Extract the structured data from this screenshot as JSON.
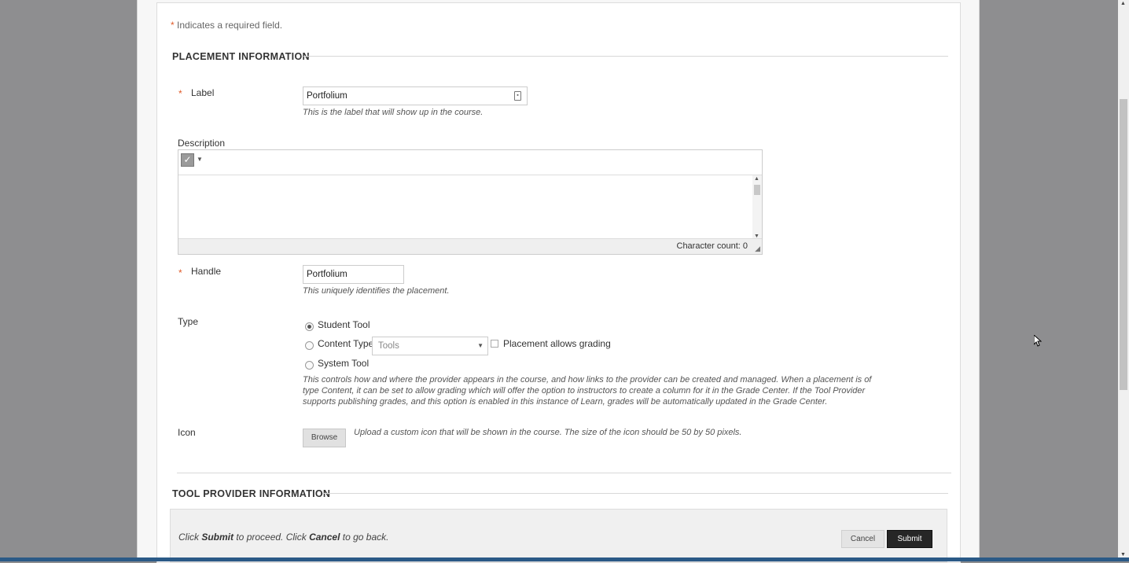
{
  "form": {
    "required_note": "Indicates a required field.",
    "required_mark": "*",
    "placement_section_title": "PLACEMENT INFORMATION",
    "label": {
      "label": "Label",
      "value": "Portfolium",
      "hint": "This is the label that will show up in the course."
    },
    "description": {
      "label": "Description",
      "char_count": "Character count: 0"
    },
    "handle": {
      "label": "Handle",
      "value": "Portfolium",
      "hint": "This uniquely identifies the placement."
    },
    "type": {
      "label": "Type",
      "options": [
        {
          "label": "Student Tool",
          "selected": true
        },
        {
          "label": "Content Type",
          "selected": false
        },
        {
          "label": "System Tool",
          "selected": false
        }
      ],
      "content_type_select": "Tools",
      "grading_checkbox_label": "Placement allows grading",
      "grading_checked": false,
      "hint": "This controls how and where the provider appears in the course, and how links to the provider can be created and managed. When a placement is of type Content, it can be set to allow grading which will offer the option to instructors to create a column for it in the Grade Center. If the Tool Provider supports publishing grades, and this option is enabled in this instance of Learn, grades will be automatically updated in the Grade Center."
    },
    "icon": {
      "label": "Icon",
      "browse_button": "Browse",
      "hint": "Upload a custom icon that will be shown in the course. The size of the icon should be 50 by 50 pixels."
    },
    "tool_provider_section_title": "TOOL PROVIDER INFORMATION"
  },
  "submit_bar": {
    "text_1": "Click ",
    "submit_word": "Submit",
    "text_2": " to proceed. Click ",
    "cancel_word": "Cancel",
    "text_3": " to go back.",
    "cancel_button": "Cancel",
    "submit_button": "Submit"
  },
  "icons": {
    "spellcheck": "spellcheck-icon",
    "field_badge": "field-lock-icon",
    "dropdown": "chevron-down-icon",
    "resize": "resize-grip-icon"
  }
}
